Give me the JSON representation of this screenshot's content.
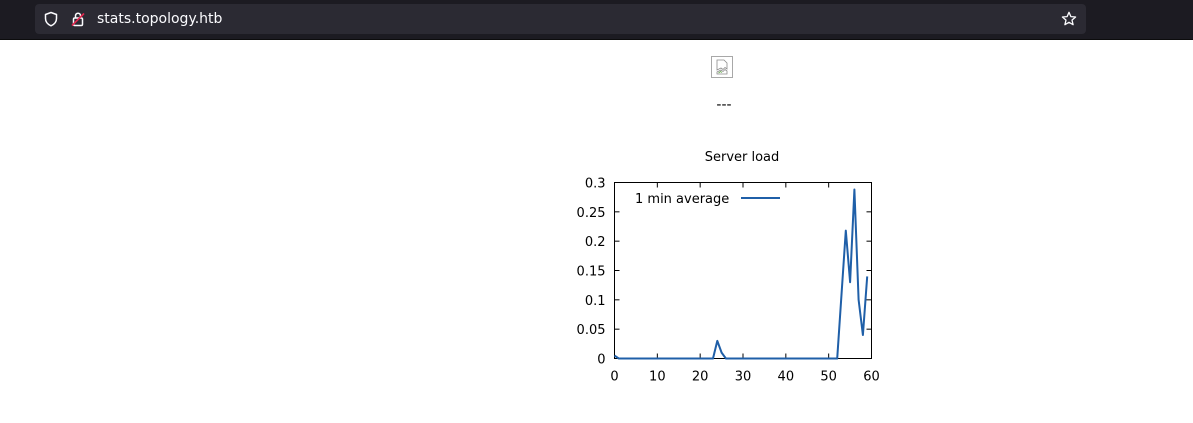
{
  "browser": {
    "url": "stats.topology.htb",
    "icons": {
      "shield": "shield-icon",
      "connection": "insecure-lock-icon",
      "bookmark": "star-icon"
    }
  },
  "page": {
    "image_icon": "broken-image-icon",
    "separator": "---"
  },
  "chart_data": {
    "type": "line",
    "title": "Server load",
    "xlabel": "",
    "ylabel": "",
    "xlim": [
      0,
      60
    ],
    "ylim": [
      0,
      0.3
    ],
    "x_ticks": [
      "0",
      "10",
      "20",
      "30",
      "40",
      "50",
      "60"
    ],
    "y_ticks": [
      "0",
      "0.05",
      "0.1",
      "0.15",
      "0.2",
      "0.25",
      "0.3"
    ],
    "grid": false,
    "legend_position": "top-left",
    "series": [
      {
        "name": "1 min average",
        "color": "#1f5fa8",
        "x": [
          0,
          1,
          2,
          4,
          6,
          8,
          10,
          12,
          14,
          16,
          18,
          20,
          22,
          23,
          24,
          25,
          26,
          28,
          30,
          32,
          34,
          36,
          38,
          40,
          42,
          44,
          46,
          48,
          50,
          51,
          52,
          54,
          55,
          56,
          57,
          58,
          59
        ],
        "y": [
          0.005,
          0,
          0,
          0,
          0,
          0,
          0,
          0,
          0,
          0,
          0,
          0,
          0,
          0,
          0.03,
          0.01,
          0,
          0,
          0,
          0,
          0,
          0,
          0,
          0,
          0,
          0,
          0,
          0,
          0,
          0,
          0,
          0.218,
          0.13,
          0.288,
          0.1,
          0.04,
          0.14
        ]
      }
    ]
  }
}
